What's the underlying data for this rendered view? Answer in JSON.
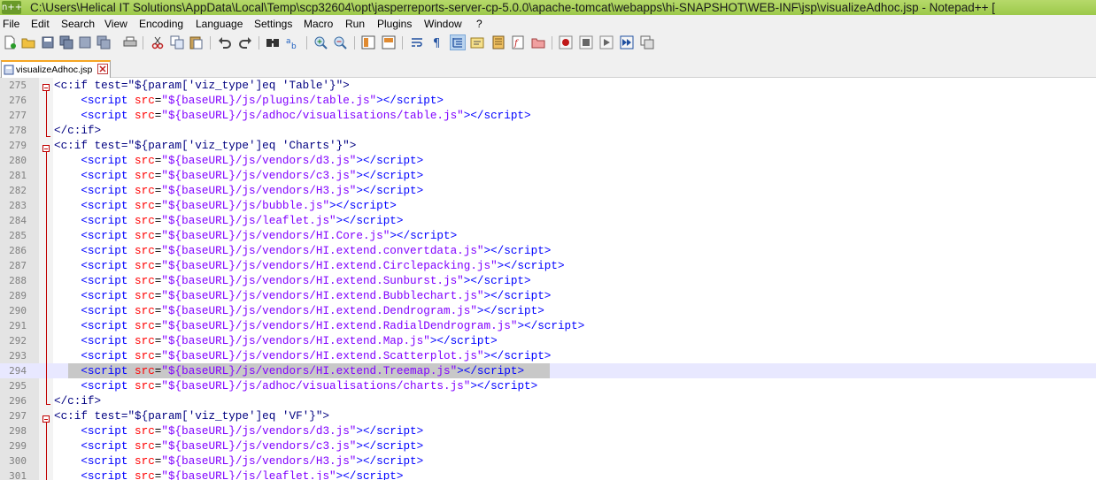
{
  "window": {
    "title": "C:\\Users\\Helical IT Solutions\\AppData\\Local\\Temp\\scp32604\\opt\\jasperreports-server-cp-5.0.0\\apache-tomcat\\webapps\\hi-SNAPSHOT\\WEB-INF\\jsp\\visualizeAdhoc.jsp - Notepad++ ["
  },
  "menu": {
    "items": [
      {
        "label": "File"
      },
      {
        "label": "Edit"
      },
      {
        "label": "Search"
      },
      {
        "label": "View"
      },
      {
        "label": "Encoding"
      },
      {
        "label": "Language"
      },
      {
        "label": "Settings"
      },
      {
        "label": "Macro"
      },
      {
        "label": "Run"
      },
      {
        "label": "Plugins"
      },
      {
        "label": "Window"
      },
      {
        "label": "?"
      }
    ]
  },
  "toolbar": {
    "icons": [
      "new-file-icon",
      "open-file-icon",
      "save-icon",
      "save-all-icon",
      "close-icon",
      "close-all-icon",
      "print-icon",
      "cut-icon",
      "copy-icon",
      "paste-icon",
      "undo-icon",
      "redo-icon",
      "find-icon",
      "replace-icon",
      "zoom-in-icon",
      "zoom-out-icon",
      "sync-vertical-icon",
      "sync-horizontal-icon",
      "word-wrap-icon",
      "show-all-characters-icon",
      "indent-guide-icon",
      "user-defined-language-icon",
      "document-map-icon",
      "function-list-icon",
      "folder-as-workspace-icon",
      "monitoring-icon",
      "record-macro-icon",
      "stop-recording-icon",
      "playback-macro-icon",
      "run-macro-multiple-icon",
      "save-macro-icon"
    ]
  },
  "tabs": [
    {
      "label": "visualizeAdhoc.jsp",
      "active": true
    }
  ],
  "editor": {
    "highlighted_line": "294",
    "lines": [
      {
        "num": "275",
        "indent": "",
        "kind": "open",
        "value": "'Table'"
      },
      {
        "num": "276",
        "indent": "    ",
        "kind": "script",
        "value": "${baseURL}/js/plugins/table.js"
      },
      {
        "num": "277",
        "indent": "    ",
        "kind": "script",
        "value": "${baseURL}/js/adhoc/visualisations/table.js"
      },
      {
        "num": "278",
        "indent": "",
        "kind": "close",
        "value": ""
      },
      {
        "num": "279",
        "indent": "",
        "kind": "open",
        "value": "'Charts'"
      },
      {
        "num": "280",
        "indent": "    ",
        "kind": "script",
        "value": "${baseURL}/js/vendors/d3.js"
      },
      {
        "num": "281",
        "indent": "    ",
        "kind": "script",
        "value": "${baseURL}/js/vendors/c3.js"
      },
      {
        "num": "282",
        "indent": "    ",
        "kind": "script",
        "value": "${baseURL}/js/vendors/H3.js"
      },
      {
        "num": "283",
        "indent": "    ",
        "kind": "script",
        "value": "${baseURL}/js/bubble.js"
      },
      {
        "num": "284",
        "indent": "    ",
        "kind": "script",
        "value": "${baseURL}/js/leaflet.js"
      },
      {
        "num": "285",
        "indent": "    ",
        "kind": "script",
        "value": "${baseURL}/js/vendors/HI.Core.js"
      },
      {
        "num": "286",
        "indent": "    ",
        "kind": "script",
        "value": "${baseURL}/js/vendors/HI.extend.convertdata.js"
      },
      {
        "num": "287",
        "indent": "    ",
        "kind": "script",
        "value": "${baseURL}/js/vendors/HI.extend.Circlepacking.js"
      },
      {
        "num": "288",
        "indent": "    ",
        "kind": "script",
        "value": "${baseURL}/js/vendors/HI.extend.Sunburst.js"
      },
      {
        "num": "289",
        "indent": "    ",
        "kind": "script",
        "value": "${baseURL}/js/vendors/HI.extend.Bubblechart.js"
      },
      {
        "num": "290",
        "indent": "    ",
        "kind": "script",
        "value": "${baseURL}/js/vendors/HI.extend.Dendrogram.js"
      },
      {
        "num": "291",
        "indent": "    ",
        "kind": "script",
        "value": "${baseURL}/js/vendors/HI.extend.RadialDendrogram.js"
      },
      {
        "num": "292",
        "indent": "    ",
        "kind": "script",
        "value": "${baseURL}/js/vendors/HI.extend.Map.js"
      },
      {
        "num": "293",
        "indent": "    ",
        "kind": "script",
        "value": "${baseURL}/js/vendors/HI.extend.Scatterplot.js"
      },
      {
        "num": "294",
        "indent": "    ",
        "kind": "script",
        "value": "${baseURL}/js/vendors/HI.extend.Treemap.js"
      },
      {
        "num": "295",
        "indent": "    ",
        "kind": "script",
        "value": "${baseURL}/js/adhoc/visualisations/charts.js"
      },
      {
        "num": "296",
        "indent": "",
        "kind": "close",
        "value": ""
      },
      {
        "num": "297",
        "indent": "",
        "kind": "open",
        "value": "'VF'"
      },
      {
        "num": "298",
        "indent": "    ",
        "kind": "script",
        "value": "${baseURL}/js/vendors/d3.js"
      },
      {
        "num": "299",
        "indent": "    ",
        "kind": "script",
        "value": "${baseURL}/js/vendors/c3.js"
      },
      {
        "num": "300",
        "indent": "    ",
        "kind": "script",
        "value": "${baseURL}/js/vendors/H3.js"
      },
      {
        "num": "301",
        "indent": "    ",
        "kind": "script",
        "value": "${baseURL}/js/leaflet.js"
      }
    ]
  }
}
